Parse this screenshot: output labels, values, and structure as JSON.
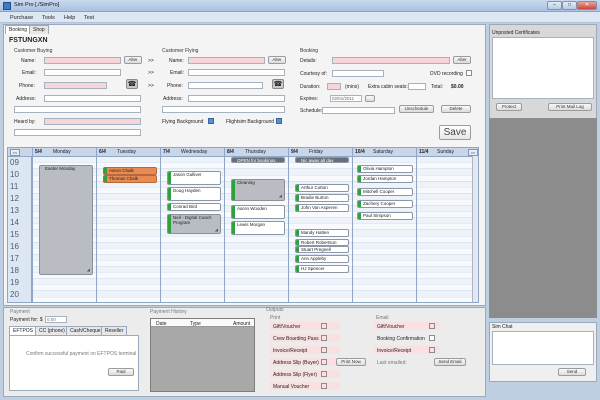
{
  "window": {
    "title": "Sim Pro [./SimPro]",
    "min": "–",
    "max": "□",
    "close": "✕"
  },
  "menu": [
    "Purchase",
    "Tools",
    "Help",
    "Test"
  ],
  "tabs": [
    "Booking",
    "Shop"
  ],
  "customer_code": "FSTUNGXN",
  "buying": {
    "section": "Customer Buying",
    "name_label": "Name:",
    "email_label": "Email:",
    "phone_label": "Phone:",
    "address_label": "Address:",
    "alter": "Alter",
    "heard_label": "Heard by:",
    "arrow": ">>"
  },
  "flying": {
    "section": "Customer Flying",
    "name_label": "Name:",
    "email_label": "Email:",
    "phone_label": "Phone:",
    "address_label": "Address:",
    "alter": "Alter",
    "flying_bg": "Flying Background",
    "flightsim_bg": "Flightsim Background"
  },
  "booking": {
    "section": "Booking",
    "details_label": "Details:",
    "alter": "Alter",
    "courtesy_label": "Courtesy of:",
    "dvd_label": "DVD recording",
    "duration_label": "Duration:",
    "duration_unit": "(mins)",
    "extra_label": "Extra cabin seats:",
    "total_label": "Total:",
    "total_value": "$0.00",
    "expires_label": "Expires:",
    "expires_value": "02/01/2011",
    "schedule_label": "Schedule:",
    "unschedule": "Unschedule",
    "delete": "Delete",
    "save": "Save"
  },
  "right": {
    "certificates_title": "Unposted Certificates",
    "protect": "Protect",
    "print_log": "Print Mail Log",
    "chat_title": "Sim Chat",
    "send": "Send"
  },
  "calendar": {
    "prev": "<<",
    "next": ">>",
    "days": [
      {
        "date": "5/4",
        "name": "Monday"
      },
      {
        "date": "6/4",
        "name": "Tuesday"
      },
      {
        "date": "7/4",
        "name": "Wednesday"
      },
      {
        "date": "8/4",
        "name": "Thursday"
      },
      {
        "date": "9/4",
        "name": "Friday"
      },
      {
        "date": "10/4",
        "name": "Saturday"
      },
      {
        "date": "11/4",
        "name": "Sunday"
      }
    ],
    "hours": [
      "09",
      "10",
      "11",
      "12",
      "13",
      "14",
      "15",
      "16",
      "17",
      "18",
      "19",
      "20"
    ],
    "appointments": {
      "mon": [
        {
          "text": "Easter Monday"
        }
      ],
      "tue": [
        {
          "text": "Aaron Chalk"
        },
        {
          "text": "Thomas Chalk"
        }
      ],
      "wed": [
        {
          "text": "Jason Gulliver"
        },
        {
          "text": "Doug Hayden"
        },
        {
          "text": "Conrad Bird"
        },
        {
          "text": "Neil - Digital Coach"
        },
        {
          "text": "Program"
        }
      ],
      "thu": [
        {
          "text": "OPEN for bookings"
        },
        {
          "text": "Cleaning"
        },
        {
          "text": "Aaron Wooden"
        },
        {
          "text": "Lewis Morgan"
        }
      ],
      "fri": [
        {
          "text": "Nic away all day"
        },
        {
          "text": "Arthur Cotton"
        },
        {
          "text": "Bradie Burton"
        },
        {
          "text": "John Van Asperen"
        },
        {
          "text": "Mandy Hatten"
        },
        {
          "text": "Robert Robertson"
        },
        {
          "text": "Stuart Pregnell"
        },
        {
          "text": "Ann Appleby"
        },
        {
          "text": "HJ Spencer"
        }
      ],
      "sat": [
        {
          "text": "Olivia Hampton"
        },
        {
          "text": "Jordan Hampton"
        },
        {
          "text": "Mitchell Cooper"
        },
        {
          "text": "Zachery Cooper"
        },
        {
          "text": "Paul Simpson"
        }
      ]
    }
  },
  "payment": {
    "title": "Payment",
    "payment_for": "Payment for: $",
    "amount": "0.00",
    "tabs": [
      "EFTPOS",
      "CC (phone)",
      "Cash/Cheque",
      "Reseller"
    ],
    "confirm": "Confirm successful payment on EFTPOS terminal",
    "paid": "Paid"
  },
  "history": {
    "title": "Payment History",
    "cols": [
      "Date",
      "Type",
      "Amount"
    ]
  },
  "outputs": {
    "title": "Outputs",
    "print_title": "Print",
    "email_title": "Email",
    "print_items": [
      "Gift/Voucher",
      "Crew Boarding Pass",
      "Invoice/Receipt",
      "Address Slip (Buyer)",
      "Address Slip (Flyer)",
      "Manual Voucher"
    ],
    "email_items": [
      "Gift/Voucher",
      "Booking Confirmation",
      "Invoice/Receipt"
    ],
    "print_now": "Print Now",
    "send_email": "Send Email",
    "last_emailed": "Last emailed:"
  }
}
